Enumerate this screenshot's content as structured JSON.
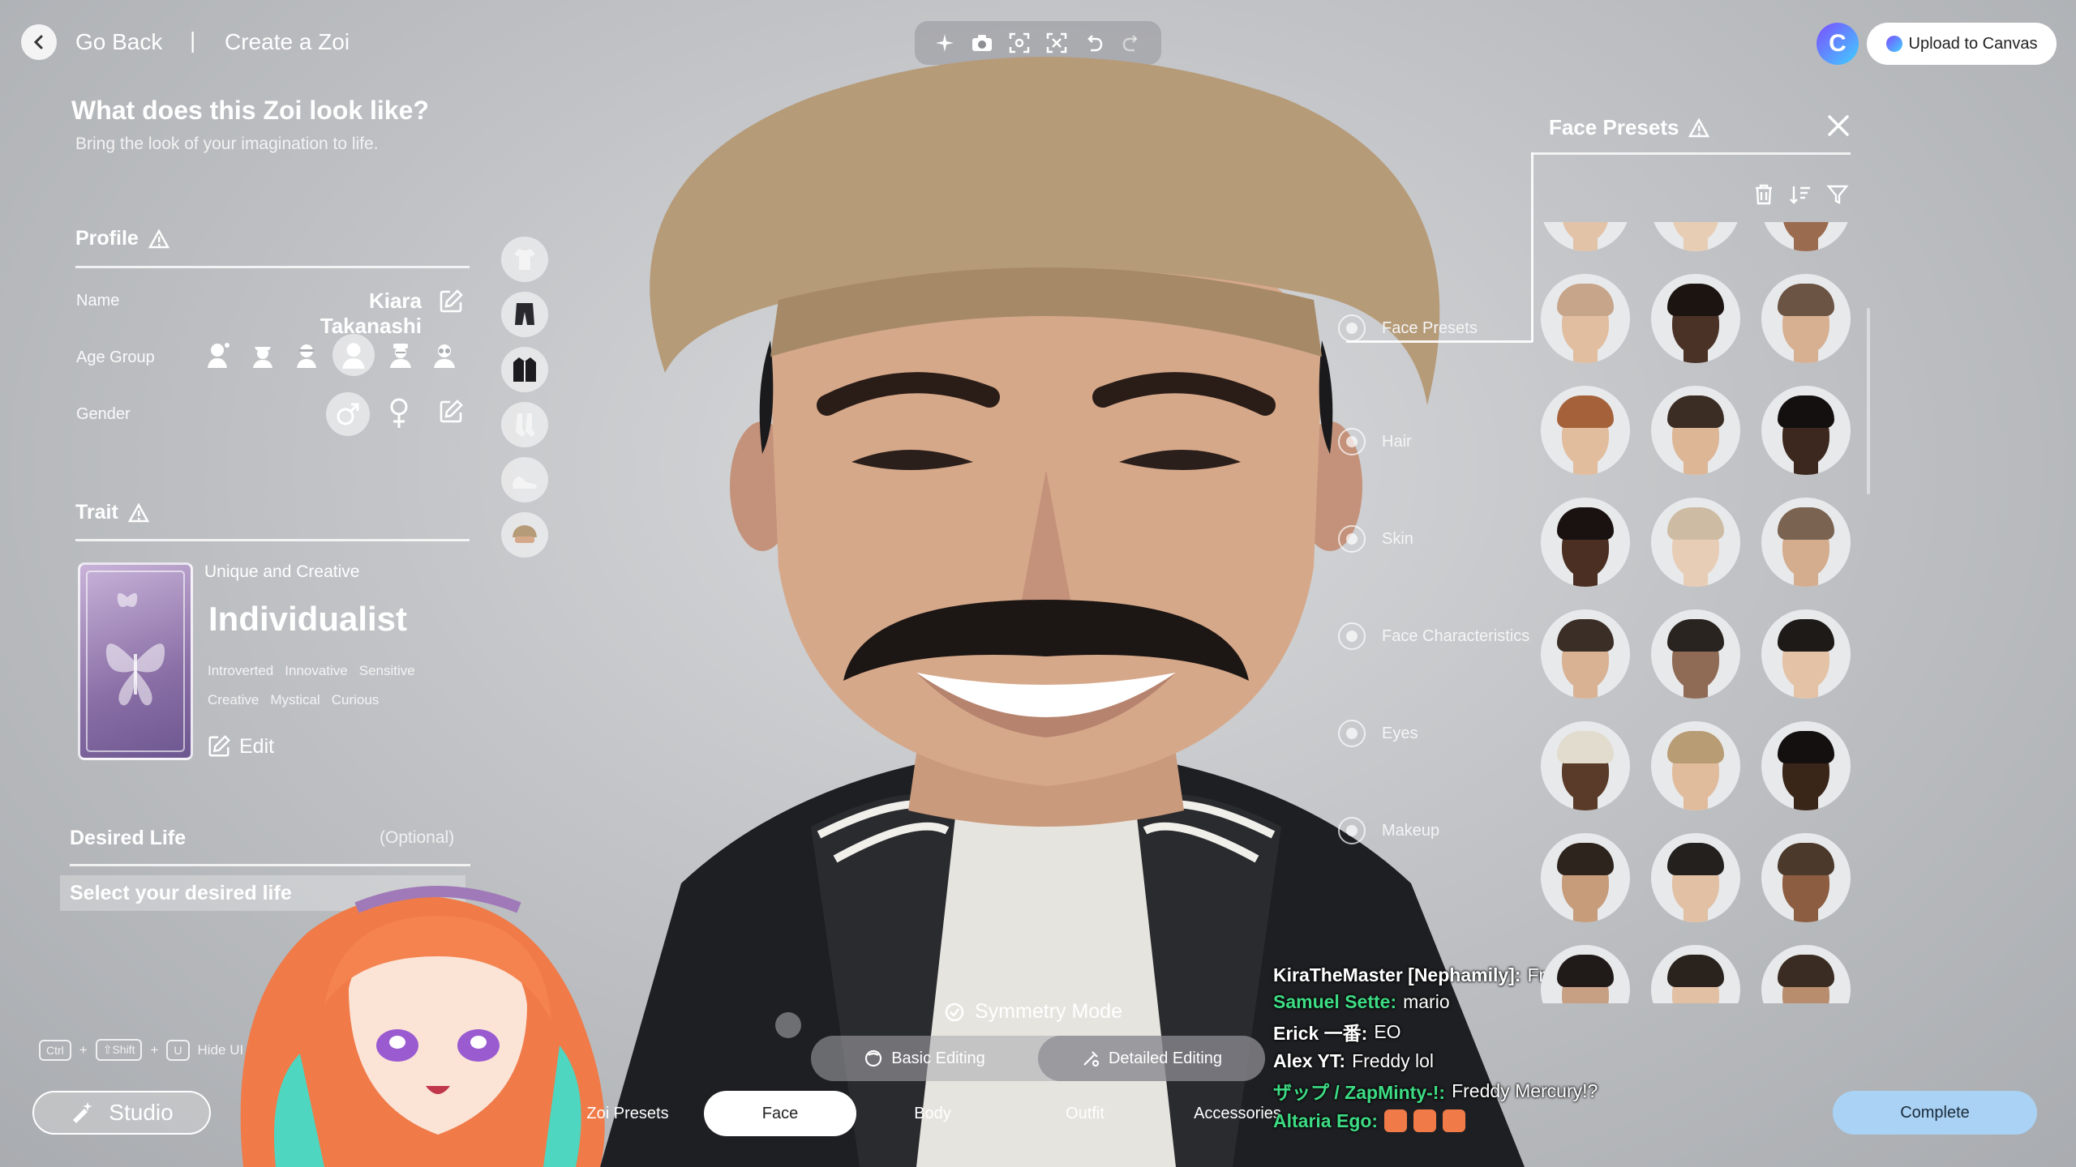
{
  "header": {
    "go_back": "Go Back",
    "separator": "|",
    "breadcrumb": "Create a Zoi",
    "upload_label": "Upload to Canvas",
    "canvas_logo_letter": "C"
  },
  "toolbar": {
    "icons": [
      "sparkle-icon",
      "camera-icon",
      "focus-frame-icon",
      "face-frame-icon",
      "undo-icon",
      "redo-icon"
    ]
  },
  "left_panel": {
    "title": "What does this Zoi look like?",
    "subtitle": "Bring the look of your imagination to life.",
    "profile": {
      "heading": "Profile",
      "name_label": "Name",
      "name_value": "Kiara Takanashi",
      "age_label": "Age Group",
      "age_icons": [
        "infant-icon",
        "toddler-icon",
        "child-icon",
        "young-adult-icon",
        "adult-icon",
        "elder-icon"
      ],
      "age_selected_index": 3,
      "gender_label": "Gender",
      "gender_selected": "male"
    },
    "trait": {
      "heading": "Trait",
      "kicker": "Unique and Creative",
      "name": "Individualist",
      "tags_row1": [
        "Introverted",
        "Innovative",
        "Sensitive"
      ],
      "tags_row2": [
        "Creative",
        "Mystical",
        "Curious"
      ],
      "edit_label": "Edit"
    },
    "desired_life": {
      "heading": "Desired Life",
      "optional": "(Optional)",
      "placeholder": "Select your desired life"
    }
  },
  "clothing_icons": [
    "top-clothing-icon",
    "bottom-clothing-icon",
    "jacket-icon",
    "socks-icon",
    "shoes-icon",
    "hat-icon"
  ],
  "hotkey_hint": {
    "keys": [
      "Ctrl",
      "⇧Shift",
      "U"
    ],
    "plus": "+",
    "label": "Hide UI"
  },
  "studio_label": "Studio",
  "center": {
    "symmetry_label": "Symmetry Mode",
    "basic_editing": "Basic Editing",
    "detailed_editing": "Detailed Editing",
    "selected_mode": "detailed"
  },
  "tabs": [
    {
      "label": "Zoi Presets",
      "selected": false
    },
    {
      "label": "Face",
      "selected": true
    },
    {
      "label": "Body",
      "selected": false
    },
    {
      "label": "Outfit",
      "selected": false
    },
    {
      "label": "Accessories",
      "selected": false
    }
  ],
  "complete_label": "Complete",
  "chat": [
    {
      "user": "KiraTheMaster [Nephamily]:",
      "msg": "Freddy lol",
      "color": "#ffffff"
    },
    {
      "user": "Samuel Sette:",
      "msg": "mario",
      "color": "#3ddc84"
    },
    {
      "user": "Erick 一番:",
      "msg": "EO",
      "color": "#ffffff"
    },
    {
      "user": "Alex YT:",
      "msg": "Freddy lol",
      "color": "#ffffff"
    },
    {
      "user": "ザップ / ZapMinty-!:",
      "msg": "Freddy Mercury!?",
      "color": "#3ddc84"
    },
    {
      "user": "Altaria Ego:",
      "msg": "",
      "color": "#3ddc84"
    }
  ],
  "right_panel": {
    "title": "Face Presets",
    "tools": [
      "trash-icon",
      "sort-icon",
      "filter-icon"
    ],
    "categories": [
      "Face Presets",
      "Hair",
      "Skin",
      "Face Characteristics",
      "Eyes",
      "Makeup"
    ],
    "presets": [
      {
        "skin": "#e3c3a8",
        "hair": "#8a6a4e"
      },
      {
        "skin": "#e8cdb5",
        "hair": "#c9b394"
      },
      {
        "skin": "#9b6b4f",
        "hair": "#2b211c"
      },
      {
        "skin": "#e2bea0",
        "hair": "#c7a58a"
      },
      {
        "skin": "#4a3226",
        "hair": "#1c1411"
      },
      {
        "skin": "#d7b092",
        "hair": "#6b5443"
      },
      {
        "skin": "#e2bd9d",
        "hair": "#a5623a"
      },
      {
        "skin": "#ddb696",
        "hair": "#3b2d24"
      },
      {
        "skin": "#3c281e",
        "hair": "#141010"
      },
      {
        "skin": "#4a2f22",
        "hair": "#1a1210"
      },
      {
        "skin": "#e8cdb6",
        "hair": "#cdbca3"
      },
      {
        "skin": "#d4ad8e",
        "hair": "#7a6350"
      },
      {
        "skin": "#d9b294",
        "hair": "#3a2e26"
      },
      {
        "skin": "#8f6a55",
        "hair": "#2a2420"
      },
      {
        "skin": "#e4c2a6",
        "hair": "#1e1a18"
      },
      {
        "skin": "#5a3a28",
        "hair": "#e2dccf"
      },
      {
        "skin": "#e0bc9c",
        "hair": "#b89c74"
      },
      {
        "skin": "#3a2519",
        "hair": "#141010"
      },
      {
        "skin": "#c79c7b",
        "hair": "#2e241e"
      },
      {
        "skin": "#e2c0a3",
        "hair": "#23201e"
      },
      {
        "skin": "#8c5d40",
        "hair": "#4b3a2c"
      },
      {
        "skin": "#c7a083",
        "hair": "#201a18"
      },
      {
        "skin": "#e2c0a3",
        "hair": "#2a221c"
      },
      {
        "skin": "#b88d6e",
        "hair": "#3a2c22"
      }
    ]
  }
}
